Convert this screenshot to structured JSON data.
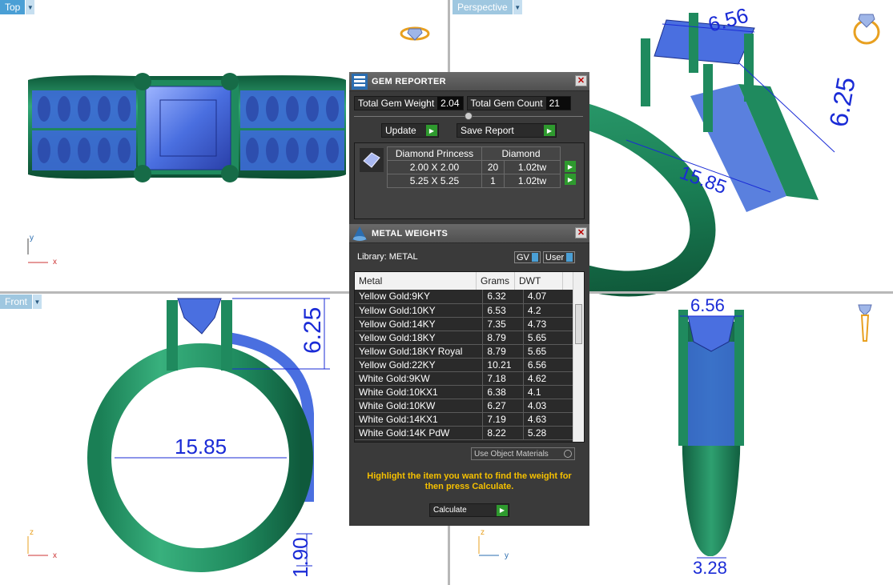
{
  "viewports": {
    "top": {
      "label": "Top"
    },
    "perspective": {
      "label": "Perspective"
    },
    "front": {
      "label": "Front"
    },
    "right": {
      "label": ""
    }
  },
  "dimensions": {
    "front_height": "6.25",
    "front_width": "15.85",
    "front_base": "1.90",
    "persp_top": "6.56",
    "persp_height": "6.25",
    "persp_width": "15.85",
    "right_top": "6.56",
    "right_bottom": "3.28"
  },
  "axes": {
    "x": "x",
    "y": "y",
    "z": "z"
  },
  "gem_reporter": {
    "title": "GEM REPORTER",
    "total_weight_label": "Total Gem Weight",
    "total_weight": "2.04",
    "total_count_label": "Total Gem Count",
    "total_count": "21",
    "update_label": "Update",
    "save_label": "Save Report",
    "table_head": {
      "shape": "Diamond Princess",
      "material": "Diamond"
    },
    "rows": [
      {
        "size": "2.00 X 2.00",
        "count": "20",
        "weight": "1.02tw"
      },
      {
        "size": "5.25 X 5.25",
        "count": "1",
        "weight": "1.02tw"
      }
    ]
  },
  "metal_weights": {
    "title": "METAL WEIGHTS",
    "library_label": "Library: METAL",
    "toggle_gv": "GV",
    "toggle_user": "User",
    "columns": {
      "metal": "Metal",
      "grams": "Grams",
      "dwt": "DWT"
    },
    "rows": [
      {
        "metal": "Yellow Gold:9KY",
        "grams": "6.32",
        "dwt": "4.07"
      },
      {
        "metal": "Yellow Gold:10KY",
        "grams": "6.53",
        "dwt": "4.2"
      },
      {
        "metal": "Yellow Gold:14KY",
        "grams": "7.35",
        "dwt": "4.73"
      },
      {
        "metal": "Yellow Gold:18KY",
        "grams": "8.79",
        "dwt": "5.65"
      },
      {
        "metal": "Yellow Gold:18KY Royal",
        "grams": "8.79",
        "dwt": "5.65"
      },
      {
        "metal": "Yellow Gold:22KY",
        "grams": "10.21",
        "dwt": "6.56"
      },
      {
        "metal": "White Gold:9KW",
        "grams": "7.18",
        "dwt": "4.62"
      },
      {
        "metal": "White Gold:10KX1",
        "grams": "6.38",
        "dwt": "4.1"
      },
      {
        "metal": "White Gold:10KW",
        "grams": "6.27",
        "dwt": "4.03"
      },
      {
        "metal": "White Gold:14KX1",
        "grams": "7.19",
        "dwt": "4.63"
      },
      {
        "metal": "White Gold:14K PdW",
        "grams": "8.22",
        "dwt": "5.28"
      }
    ],
    "use_object_materials": "Use Object Materials",
    "hint": "Highlight the item you want to find the weight for then press Calculate.",
    "calculate_label": "Calculate",
    "hint_color": "#f5c000"
  },
  "colors": {
    "ring_green": "#1f8a5e",
    "gem_blue": "#4a6fe0",
    "dim_blue": "#1a2bd6",
    "viewport_tab": "#4a9fd5"
  }
}
